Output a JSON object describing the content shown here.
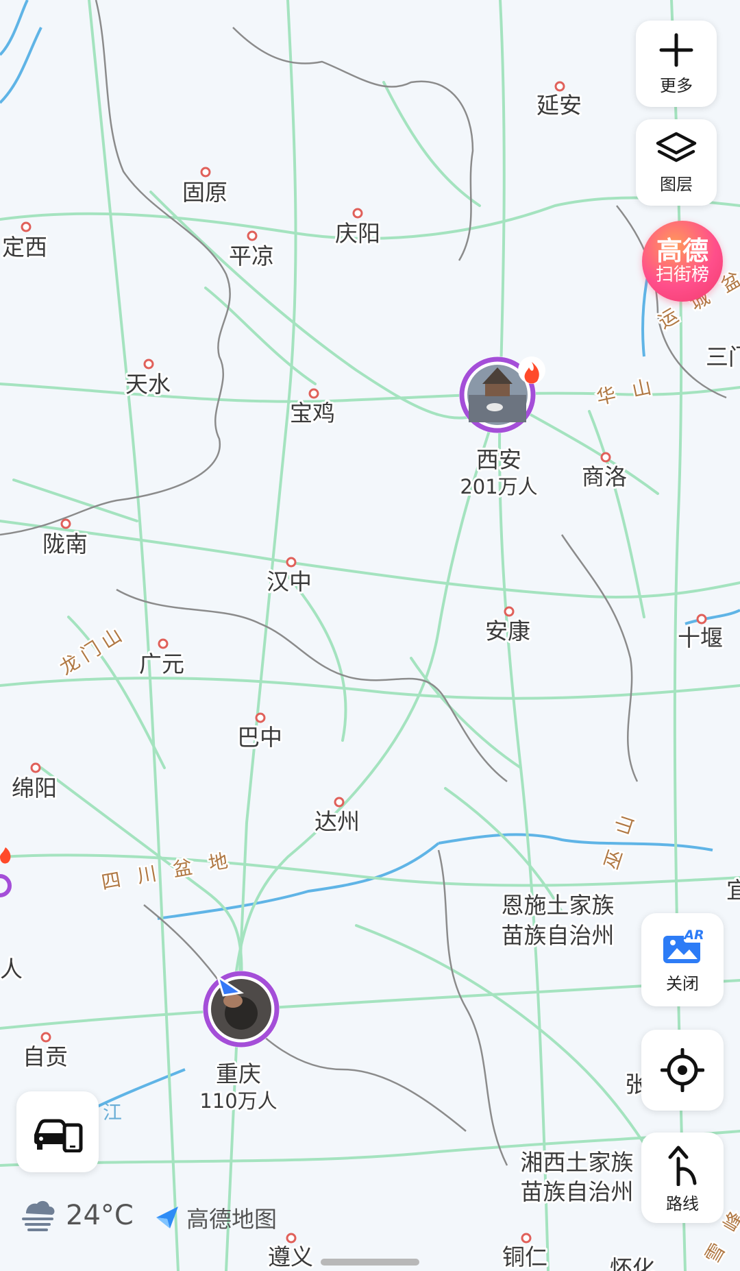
{
  "map": {
    "cities": [
      {
        "id": "yanan",
        "name": "延安"
      },
      {
        "id": "guyuan",
        "name": "固原"
      },
      {
        "id": "dingxi",
        "name": "定西"
      },
      {
        "id": "pingliang",
        "name": "平凉"
      },
      {
        "id": "qingyang",
        "name": "庆阳"
      },
      {
        "id": "tianshui",
        "name": "天水"
      },
      {
        "id": "baoji",
        "name": "宝鸡"
      },
      {
        "id": "shangluo",
        "name": "商洛"
      },
      {
        "id": "longnan",
        "name": "陇南"
      },
      {
        "id": "hanzhong",
        "name": "汉中"
      },
      {
        "id": "ankang",
        "name": "安康"
      },
      {
        "id": "shiyan",
        "name": "十堰"
      },
      {
        "id": "guangyuan",
        "name": "广元"
      },
      {
        "id": "bazhong",
        "name": "巴中"
      },
      {
        "id": "mianyang",
        "name": "绵阳"
      },
      {
        "id": "dazhou",
        "name": "达州"
      },
      {
        "id": "enshi",
        "name": "恩施土家族\n苗族自治州"
      },
      {
        "id": "zigong",
        "name": "自贡"
      },
      {
        "id": "xiangxi",
        "name": "湘西土家族\n苗族自治州"
      },
      {
        "id": "zunyi",
        "name": "遵义"
      },
      {
        "id": "tongren",
        "name": "铜仁"
      },
      {
        "id": "sanmen",
        "name": "三门"
      },
      {
        "id": "yi",
        "name": "宜"
      },
      {
        "id": "zhang",
        "name": "张"
      },
      {
        "id": "huaihua",
        "name": "怀化"
      }
    ],
    "hot_cities": [
      {
        "id": "xian",
        "name": "西安",
        "population": "201万人"
      },
      {
        "id": "chongqing",
        "name": "重庆",
        "population": "110万人"
      }
    ],
    "region_labels": {
      "huashan": "华 山",
      "yuncheng": "运 城 盆",
      "longmenshan": "龙门山",
      "sichuan_basin": "四 川 盆 地",
      "wushan": "巫 山",
      "xuefeng": "雪 峰"
    },
    "water_labels": {
      "jiang": "江"
    },
    "colors": {
      "road": "#9fe0b9",
      "border": "#7a7a7a",
      "water": "#5fb4e6",
      "dot": "#e0605a",
      "mountain_text": "#b07843"
    }
  },
  "controls": {
    "more": {
      "label": "更多",
      "icon": "plus-icon"
    },
    "layers": {
      "label": "图层",
      "icon": "layers-icon"
    },
    "rank": {
      "line1": "高德",
      "line2": "扫街榜"
    },
    "ar": {
      "label": "关闭",
      "icon": "ar-scene-icon",
      "badge": "AR"
    },
    "locate": {
      "icon": "crosshair-icon"
    },
    "route": {
      "label": "路线",
      "icon": "route-arrow-icon"
    },
    "vehicle": {
      "icon": "car-phone-icon"
    }
  },
  "weather": {
    "temp": "24°C",
    "icon": "fog-icon"
  },
  "brand": {
    "name": "高德地图",
    "icon": "amap-logo-icon"
  }
}
